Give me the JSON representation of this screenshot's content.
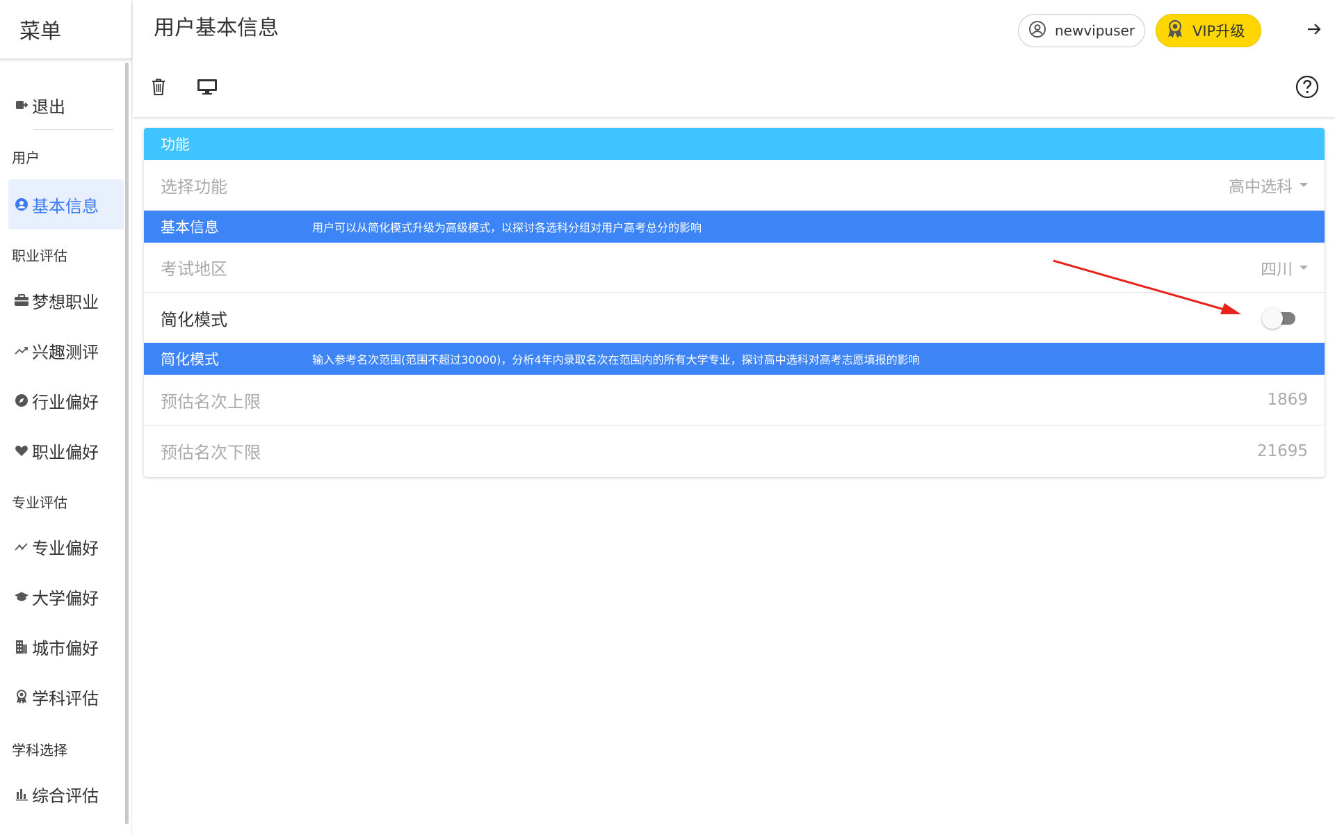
{
  "sidebar": {
    "title": "菜单",
    "logout": {
      "label": "退出",
      "icon": "logout-icon"
    },
    "sections": {
      "user": "用户",
      "career": "职业评估",
      "major": "专业评估",
      "subject": "学科选择"
    },
    "items": {
      "basic_info": {
        "label": "基本信息",
        "icon": "user-circle-icon"
      },
      "dream_career": {
        "label": "梦想职业",
        "icon": "briefcase-icon"
      },
      "interest_test": {
        "label": "兴趣测评",
        "icon": "trend-icon"
      },
      "industry_pref": {
        "label": "行业偏好",
        "icon": "compass-icon"
      },
      "career_pref": {
        "label": "职业偏好",
        "icon": "heart-icon"
      },
      "major_pref": {
        "label": "专业偏好",
        "icon": "trend-icon"
      },
      "university_pref": {
        "label": "大学偏好",
        "icon": "graduation-cap-icon"
      },
      "city_pref": {
        "label": "城市偏好",
        "icon": "building-icon"
      },
      "subject_eval": {
        "label": "学科评估",
        "icon": "award-icon"
      },
      "overall_eval": {
        "label": "综合评估",
        "icon": "bar-chart-icon"
      }
    }
  },
  "header": {
    "title": "用户基本信息",
    "username": "newvipuser",
    "vip_label": "VIP升级"
  },
  "card": {
    "header": "功能",
    "select_function": {
      "label": "选择功能",
      "value": "高中选科"
    },
    "basic_band": {
      "title": "基本信息",
      "desc": "用户可以从简化模式升级为高级模式，以探讨各选科分组对用户高考总分的影响"
    },
    "exam_region": {
      "label": "考试地区",
      "value": "四川"
    },
    "simple_mode": {
      "label": "简化模式",
      "enabled": false
    },
    "simple_band": {
      "title": "简化模式",
      "desc": "输入参考名次范围(范围不超过30000)，分析4年内录取名次在范围内的所有大学专业，探讨高中选科对高考志愿填报的影响"
    },
    "rank_upper": {
      "label": "预估名次上限",
      "value": "1869"
    },
    "rank_lower": {
      "label": "预估名次下限",
      "value": "21695"
    }
  },
  "colors": {
    "accent": "#3d7cf0",
    "card_header": "#40c4ff",
    "band": "#3d85f6",
    "vip": "#ffd600",
    "annotation_arrow": "#e8231c"
  }
}
